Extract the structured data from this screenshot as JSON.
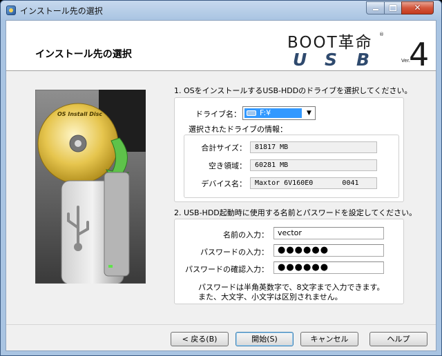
{
  "window": {
    "title": "インストール先の選択"
  },
  "header": {
    "page_title": "インストール先の選択",
    "logo": {
      "boot": "BOOT",
      "kanji": "革命",
      "reg": "®",
      "usb": [
        "U",
        "S",
        "B"
      ],
      "ver": "Ver.",
      "num": "4"
    }
  },
  "illustration": {
    "disc_label": "OS Install Disc"
  },
  "drive_section": {
    "label": "1. OSをインストールするUSB-HDDのドライブを選択してください。",
    "drive_label": "ドライブ名：",
    "drive_value": "F:¥",
    "info_label": "選択されたドライブの情報：",
    "total_label": "合計サイズ：",
    "total_value": "81817 MB",
    "free_label": "空き領域：",
    "free_value": "60281 MB",
    "device_label": "デバイス名：",
    "device_value": "Maxtor 6V160E0       0041"
  },
  "account_section": {
    "label": "2. USB-HDD起動時に使用する名前とパスワードを設定してください。",
    "name_label": "名前の入力：",
    "name_value": "vector",
    "pw_label": "パスワードの入力：",
    "pw_value": "●●●●●●",
    "pw_confirm_label": "パスワードの確認入力：",
    "pw_confirm_value": "●●●●●●",
    "note_line1": "パスワードは半角英数字で、8文字まで入力できます。",
    "note_line2": "また、大文字、小文字は区別されません。"
  },
  "buttons": {
    "back": "< 戻る(B)",
    "start": "開始(S)",
    "cancel": "キャンセル",
    "help": "ヘルプ"
  },
  "colors": {
    "accent": "#3399ff",
    "logo_usb": "#2f4a6e",
    "titlebar": "#a9c4e2",
    "close": "#c43a1e"
  }
}
